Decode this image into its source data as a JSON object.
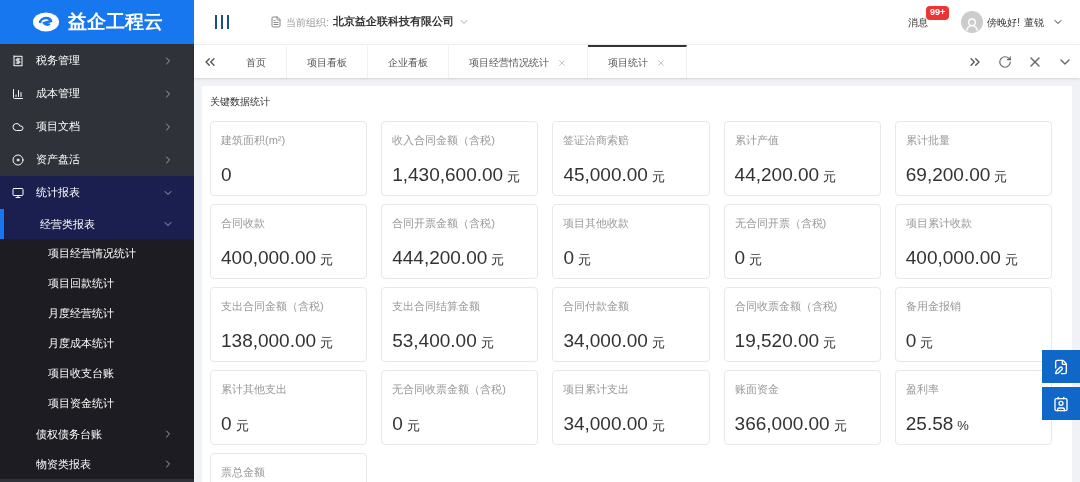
{
  "logo": {
    "name": "益企工程云"
  },
  "header": {
    "org_label": "当前组织:",
    "org_name": "北京益企联科技有限公司",
    "messages": "消息",
    "badge": "99+",
    "greeting": "傍晚好!",
    "user": "董锐"
  },
  "sidebar": {
    "items": [
      {
        "label": "税务管理",
        "expanded": false
      },
      {
        "label": "成本管理",
        "expanded": false
      },
      {
        "label": "项目文档",
        "expanded": false
      },
      {
        "label": "资产盘活",
        "expanded": false
      },
      {
        "label": "统计报表",
        "expanded": true,
        "children": [
          {
            "label": "经营类报表",
            "expanded": true,
            "children": [
              {
                "label": "项目经营情况统计"
              },
              {
                "label": "项目回款统计"
              },
              {
                "label": "月度经营统计"
              },
              {
                "label": "月度成本统计"
              },
              {
                "label": "项目收支台账"
              },
              {
                "label": "项目资金统计"
              }
            ]
          },
          {
            "label": "债权债务台账",
            "expanded": false
          },
          {
            "label": "物资类报表",
            "expanded": false
          }
        ]
      }
    ]
  },
  "tabs": [
    {
      "label": "首页",
      "selected": false,
      "closable": false
    },
    {
      "label": "项目看板",
      "selected": false,
      "closable": false
    },
    {
      "label": "企业看板",
      "selected": false,
      "closable": false
    },
    {
      "label": "项目经营情况统计",
      "selected": false,
      "closable": true
    },
    {
      "label": "项目统计",
      "selected": true,
      "closable": true
    }
  ],
  "panel": {
    "title": "关键数据统计",
    "cards": [
      {
        "label": "建筑面积(m²)",
        "value": "0"
      },
      {
        "label": "收入合同金额（含税)",
        "value": "1,430,600.00",
        "unit": "元"
      },
      {
        "label": "签证洽商索赔",
        "value": "45,000.00",
        "unit": "元"
      },
      {
        "label": "累计产值",
        "value": "44,200.00",
        "unit": "元"
      },
      {
        "label": "累计批量",
        "value": "69,200.00",
        "unit": "元"
      },
      {
        "label": "合同收款",
        "value": "400,000.00",
        "unit": "元"
      },
      {
        "label": "合同开票金额（含税)",
        "value": "444,200.00",
        "unit": "元"
      },
      {
        "label": "项目其他收款",
        "value": "0",
        "unit": "元"
      },
      {
        "label": "无合同开票（含税)",
        "value": "0",
        "unit": "元"
      },
      {
        "label": "项目累计收款",
        "value": "400,000.00",
        "unit": "元"
      },
      {
        "label": "支出合同金额（含税)",
        "value": "138,000.00",
        "unit": "元"
      },
      {
        "label": "支出合同结算金额",
        "value": "53,400.00",
        "unit": "元"
      },
      {
        "label": "合同付款金额",
        "value": "34,000.00",
        "unit": "元"
      },
      {
        "label": "合同收票金额（含税)",
        "value": "19,520.00",
        "unit": "元"
      },
      {
        "label": "备用金报销",
        "value": "0",
        "unit": "元"
      },
      {
        "label": "累计其他支出",
        "value": "0",
        "unit": "元"
      },
      {
        "label": "无合同收票金额（含税)",
        "value": "0",
        "unit": "元"
      },
      {
        "label": "项目累计支出",
        "value": "34,000.00",
        "unit": "元"
      },
      {
        "label": "账面资金",
        "value": "366,000.00",
        "unit": "元"
      },
      {
        "label": "盈利率",
        "value": "25.58",
        "unit": "%"
      },
      {
        "label": "票总金额"
      }
    ]
  }
}
